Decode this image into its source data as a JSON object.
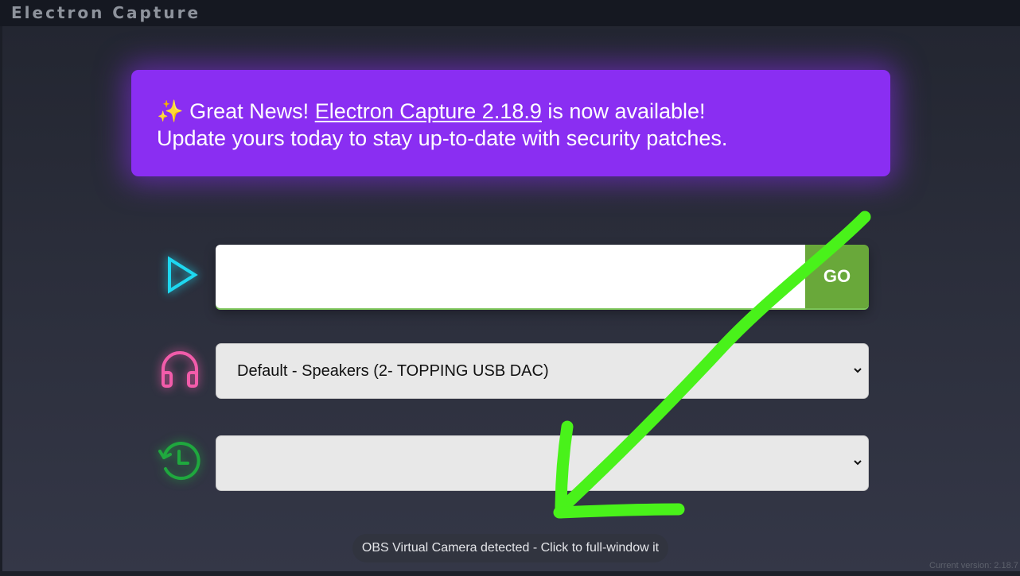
{
  "window": {
    "title": "Electron Capture"
  },
  "banner": {
    "sparkle": "✨",
    "line1_prefix": "Great News!",
    "link_text": "Electron Capture 2.18.9",
    "line1_suffix": "is now available!",
    "line2": "Update yours today to stay up-to-date with security patches."
  },
  "url_row": {
    "icon": "play-icon",
    "input_value": "",
    "go_label": "GO"
  },
  "audio_row": {
    "icon": "headphones-icon",
    "selected": "Default - Speakers (2- TOPPING USB DAC)"
  },
  "history_row": {
    "icon": "history-icon",
    "selected": ""
  },
  "toast": {
    "text": "OBS Virtual Camera detected - Click to full-window it"
  },
  "footer": {
    "version": "Current version: 2.18.7"
  },
  "colors": {
    "banner": "#8a2ef2",
    "go_button": "#69a83a",
    "play_icon": "#1ed8f0",
    "headphones_icon": "#f25caa",
    "history_icon": "#1fa83e",
    "annotation_arrow": "#49f21a"
  }
}
